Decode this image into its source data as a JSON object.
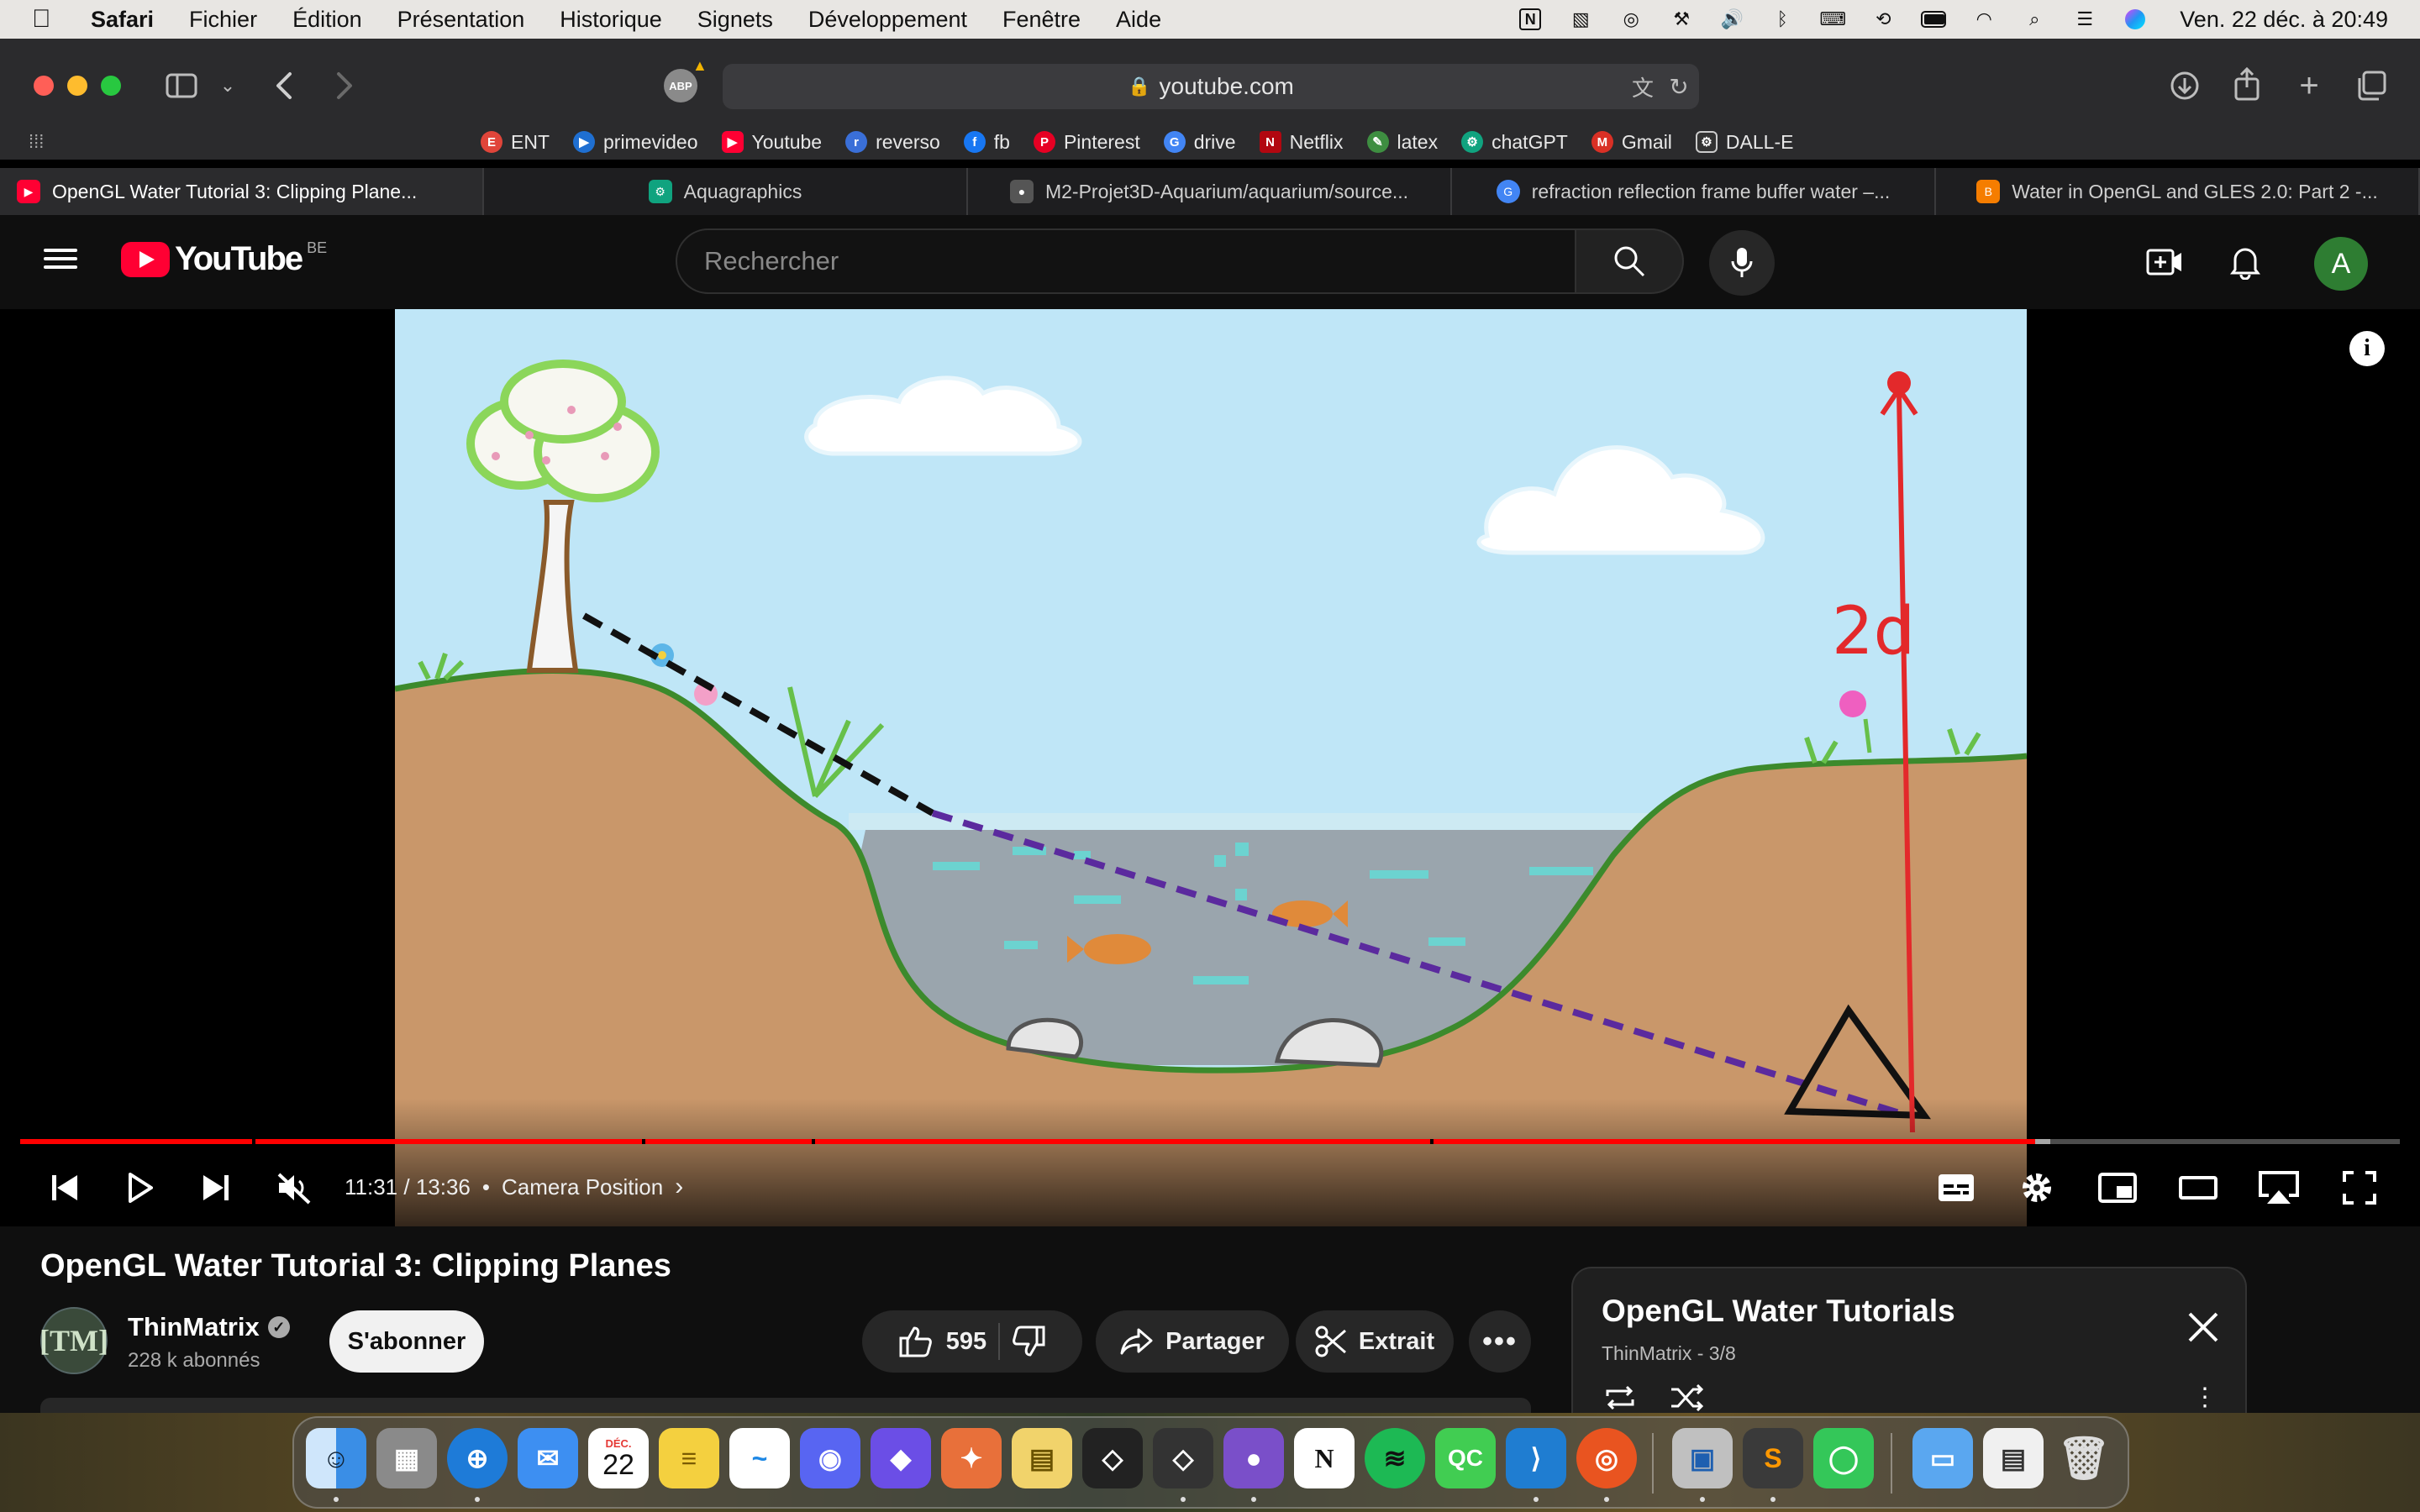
{
  "menubar": {
    "app": "Safari",
    "items": [
      "Fichier",
      "Édition",
      "Présentation",
      "Historique",
      "Signets",
      "Développement",
      "Fenêtre",
      "Aide"
    ],
    "clock": "Ven. 22 déc. à 20:49"
  },
  "browser": {
    "url": "youtube.com",
    "abp_label": "ABP",
    "favorites": [
      {
        "label": "ENT",
        "color": "#e0453a",
        "glyph": "E"
      },
      {
        "label": "primevideo",
        "color": "#1f6fd1",
        "glyph": "▶"
      },
      {
        "label": "Youtube",
        "color": "#ff0033",
        "glyph": "▶"
      },
      {
        "label": "reverso",
        "color": "#3a6fd8",
        "glyph": "r"
      },
      {
        "label": "fb",
        "color": "#1877f2",
        "glyph": "f"
      },
      {
        "label": "Pinterest",
        "color": "#e60023",
        "glyph": "P"
      },
      {
        "label": "drive",
        "color": "#4285f4",
        "glyph": "G"
      },
      {
        "label": "Netflix",
        "color": "#b20710",
        "glyph": "N"
      },
      {
        "label": "latex",
        "color": "#3e8e41",
        "glyph": "✎"
      },
      {
        "label": "chatGPT",
        "color": "#10a37f",
        "glyph": "⚙"
      },
      {
        "label": "Gmail",
        "color": "#d93025",
        "glyph": "M"
      },
      {
        "label": "DALL-E",
        "color": "#333333",
        "glyph": "⚙"
      }
    ],
    "tabs": [
      {
        "label": "OpenGL Water Tutorial 3: Clipping Plane...",
        "color": "#ff0033",
        "glyph": "▶"
      },
      {
        "label": "Aquagraphics",
        "color": "#10a37f",
        "glyph": "⚙"
      },
      {
        "label": "M2-Projet3D-Aquarium/aquarium/source...",
        "color": "#555555",
        "glyph": "●"
      },
      {
        "label": "refraction reflection frame buffer water –...",
        "color": "#4285f4",
        "glyph": "G"
      },
      {
        "label": "Water in OpenGL and GLES 2.0: Part 2 -...",
        "color": "#f57d00",
        "glyph": "B"
      }
    ]
  },
  "youtube": {
    "logo_word": "YouTube",
    "country": "BE",
    "search_placeholder": "Rechercher",
    "avatar_letter": "A"
  },
  "player": {
    "time_current": "11:31",
    "time_total": "13:36",
    "chapter": "Camera Position",
    "progress_played_fraction": 0.8467,
    "progress_buffered_fraction": 0.853,
    "drawing_label": "2d",
    "info_glyph": "i"
  },
  "video": {
    "title": "OpenGL Water Tutorial 3: Clipping Planes",
    "channel": "ThinMatrix",
    "channel_avatar_text": "[TM]",
    "subscribers": "228 k abonnés",
    "subscribe_label": "S'abonner",
    "likes": "595",
    "share_label": "Partager",
    "clip_label": "Extrait"
  },
  "playlist": {
    "title": "OpenGL Water Tutorials",
    "subtitle": "ThinMatrix - 3/8"
  },
  "dock": {
    "calendar_month": "DÉC.",
    "calendar_day": "22",
    "apps": [
      {
        "name": "finder",
        "color": "#3a8ee6",
        "glyph": "☺"
      },
      {
        "name": "launchpad",
        "color": "#8a8a8a",
        "glyph": "▦"
      },
      {
        "name": "safari",
        "color": "#1e7bd8",
        "glyph": "⊕"
      },
      {
        "name": "mail",
        "color": "#3d8ff2",
        "glyph": "✉"
      },
      {
        "name": "calendar",
        "color": "#ffffff",
        "glyph": ""
      },
      {
        "name": "notes",
        "color": "#f4d03f",
        "glyph": "≡"
      },
      {
        "name": "freeform",
        "color": "#ffffff",
        "glyph": "~"
      },
      {
        "name": "discord",
        "color": "#5865f2",
        "glyph": "◉"
      },
      {
        "name": "shortcuts",
        "color": "#6b4ee6",
        "glyph": "◆"
      },
      {
        "name": "pixelmator",
        "color": "#e8703a",
        "glyph": "✦"
      },
      {
        "name": "stickies",
        "color": "#f1d36b",
        "glyph": "▤"
      },
      {
        "name": "unity",
        "color": "#222222",
        "glyph": "◇"
      },
      {
        "name": "unity-hub",
        "color": "#333333",
        "glyph": "◇"
      },
      {
        "name": "github-desktop",
        "color": "#7a4fc9",
        "glyph": "●"
      },
      {
        "name": "notion",
        "color": "#ffffff",
        "glyph": "N"
      },
      {
        "name": "spotify",
        "color": "#1db954",
        "glyph": "≋"
      },
      {
        "name": "qt-creator",
        "color": "#41cd52",
        "glyph": "QC"
      },
      {
        "name": "vscode",
        "color": "#1f7dd1",
        "glyph": "⟩"
      },
      {
        "name": "ubuntu",
        "color": "#e95420",
        "glyph": "◎"
      },
      {
        "name": "parallels",
        "color": "#c0c0c0",
        "glyph": "▣"
      },
      {
        "name": "sublime-text",
        "color": "#3a3a3a",
        "glyph": "S"
      },
      {
        "name": "messages",
        "color": "#34c759",
        "glyph": "◯"
      },
      {
        "name": "downloads-folder",
        "color": "#5aa7f0",
        "glyph": "▭"
      },
      {
        "name": "recent-document",
        "color": "#f0f0f0",
        "glyph": "▤"
      },
      {
        "name": "trash",
        "color": "#9a9a9a",
        "glyph": "🗑"
      }
    ]
  }
}
